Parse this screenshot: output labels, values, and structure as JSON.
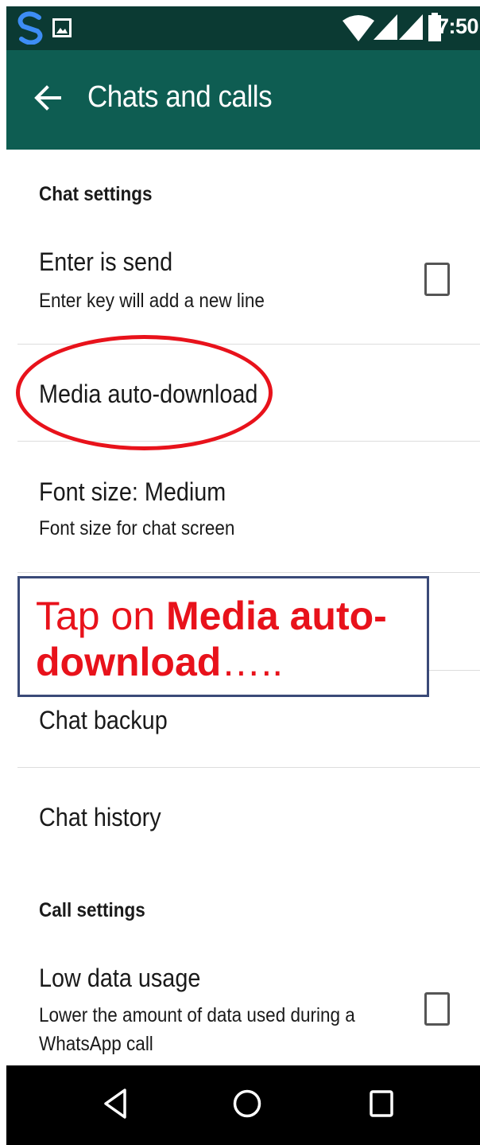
{
  "status_bar": {
    "time": "7:50",
    "icons": [
      "sync-s-icon",
      "image-icon",
      "wifi-icon",
      "signal-icon",
      "signal-icon",
      "battery-icon"
    ]
  },
  "app_bar": {
    "title": "Chats and calls",
    "back_icon": "arrow-back-icon"
  },
  "sections": {
    "chat_settings": "Chat settings",
    "call_settings": "Call settings"
  },
  "rows": {
    "enter_is_send": {
      "title": "Enter is send",
      "subtitle": "Enter key will add a new line",
      "checked": false
    },
    "media_auto_download": {
      "title": "Media auto-download"
    },
    "font_size": {
      "title": "Font size: Medium",
      "subtitle": "Font size for chat screen"
    },
    "chat_backup": {
      "title": "Chat backup"
    },
    "chat_history": {
      "title": "Chat history"
    },
    "low_data_usage": {
      "title": "Low data usage",
      "subtitle_line1": "Lower the amount of data used during a",
      "subtitle_line2": "WhatsApp call",
      "checked": false
    }
  },
  "annotation": {
    "prefix": "Tap on ",
    "bold": "Media auto-download",
    "suffix": "…..",
    "color": "#e8121b"
  },
  "nav_bar": {
    "icons": [
      "back-triangle-icon",
      "home-circle-icon",
      "recents-square-icon"
    ]
  },
  "colors": {
    "status_bar": "#0b3a33",
    "app_bar": "#0e5d52",
    "accent_red": "#e8121b"
  }
}
